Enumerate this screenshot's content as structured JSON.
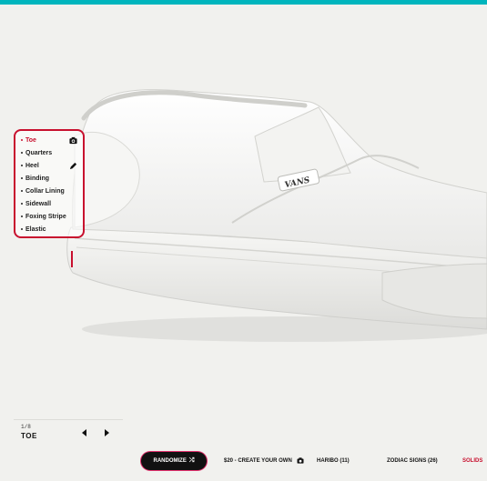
{
  "theme": {
    "accent": "#00b5bd",
    "highlight": "#c8102e",
    "background": "#f1f1ee"
  },
  "shoe": {
    "brand_label": "VANS"
  },
  "parts_panel": {
    "items": [
      {
        "label": "Toe",
        "active": true,
        "tool_icon": "camera-icon"
      },
      {
        "label": "Quarters"
      },
      {
        "label": "Heel",
        "tool_icon": "pencil-icon"
      },
      {
        "label": "Binding"
      },
      {
        "label": "Collar Lining"
      },
      {
        "label": "Sidewall"
      },
      {
        "label": "Foxing Stripe"
      },
      {
        "label": "Elastic"
      }
    ]
  },
  "step_nav": {
    "count": "1/8",
    "current": "TOE",
    "prev_icon": "arrow-left-icon",
    "next_icon": "arrow-right-icon"
  },
  "toolbar": {
    "randomize_label": "RANDOMIZE",
    "randomize_icon": "shuffle-icon",
    "links": [
      {
        "label": "$20 - CREATE YOUR OWN",
        "icon": "camera-icon"
      },
      {
        "label": "HARIBO (11)"
      },
      {
        "label": "ZODIAC SIGNS (26)"
      },
      {
        "label": "SOLIDS",
        "active": true
      }
    ]
  }
}
